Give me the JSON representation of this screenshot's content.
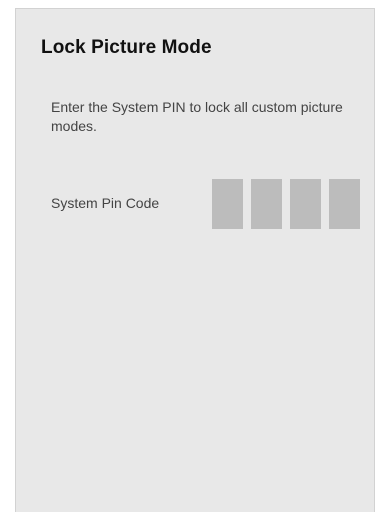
{
  "dialog": {
    "title": "Lock Picture Mode",
    "description": "Enter the System PIN to lock all custom picture modes.",
    "pin_label": "System Pin Code",
    "pin_digits": [
      "",
      "",
      "",
      ""
    ]
  },
  "colors": {
    "panel_background": "#e8e8e8",
    "pin_box": "#bcbcbc",
    "title_text": "#111111",
    "body_text": "#444444"
  }
}
